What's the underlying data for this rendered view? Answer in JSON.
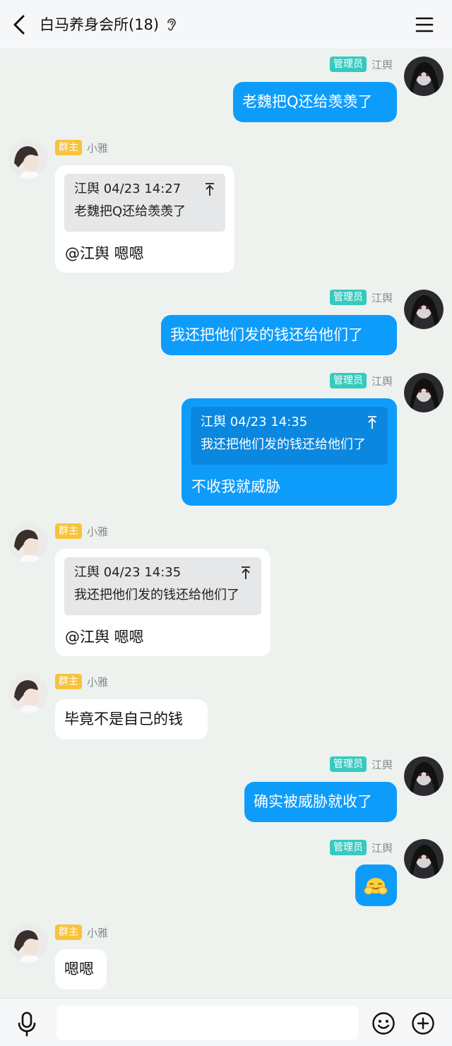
{
  "header": {
    "title": "白马养身会所(18)"
  },
  "users": {
    "admin": {
      "name": "江舆",
      "role": "管理员"
    },
    "owner": {
      "name": "小雅",
      "role": "群主"
    }
  },
  "messages": [
    {
      "text": "老魏把Q还给羡羡了"
    },
    {
      "quote_header": "江舆 04/23 14:27",
      "quote_text": "老魏把Q还给羡羡了",
      "text": "@江舆 嗯嗯"
    },
    {
      "text": "我还把他们发的钱还给他们了"
    },
    {
      "quote_header": "江舆 04/23 14:35",
      "quote_text": "我还把他们发的钱还给他们了",
      "text": "不收我就威胁"
    },
    {
      "quote_header": "江舆 04/23 14:35",
      "quote_text": "我还把他们发的钱还给他们了",
      "text": "@江舆 嗯嗯"
    },
    {
      "text": "毕竟不是自己的钱"
    },
    {
      "text": "确实被威胁就收了"
    },
    {
      "sticker": "hug-emoji"
    },
    {
      "text": "嗯嗯"
    }
  ],
  "colors": {
    "outgoing_bubble": "#0e9cfb",
    "admin_badge": "#38c9bf",
    "owner_badge": "#f8c33b",
    "background": "#edf2ee"
  },
  "icons": [
    "back-icon",
    "ear-icon",
    "menu-icon",
    "mic-icon",
    "emoji-icon",
    "plus-icon",
    "top-arrow-icon"
  ]
}
